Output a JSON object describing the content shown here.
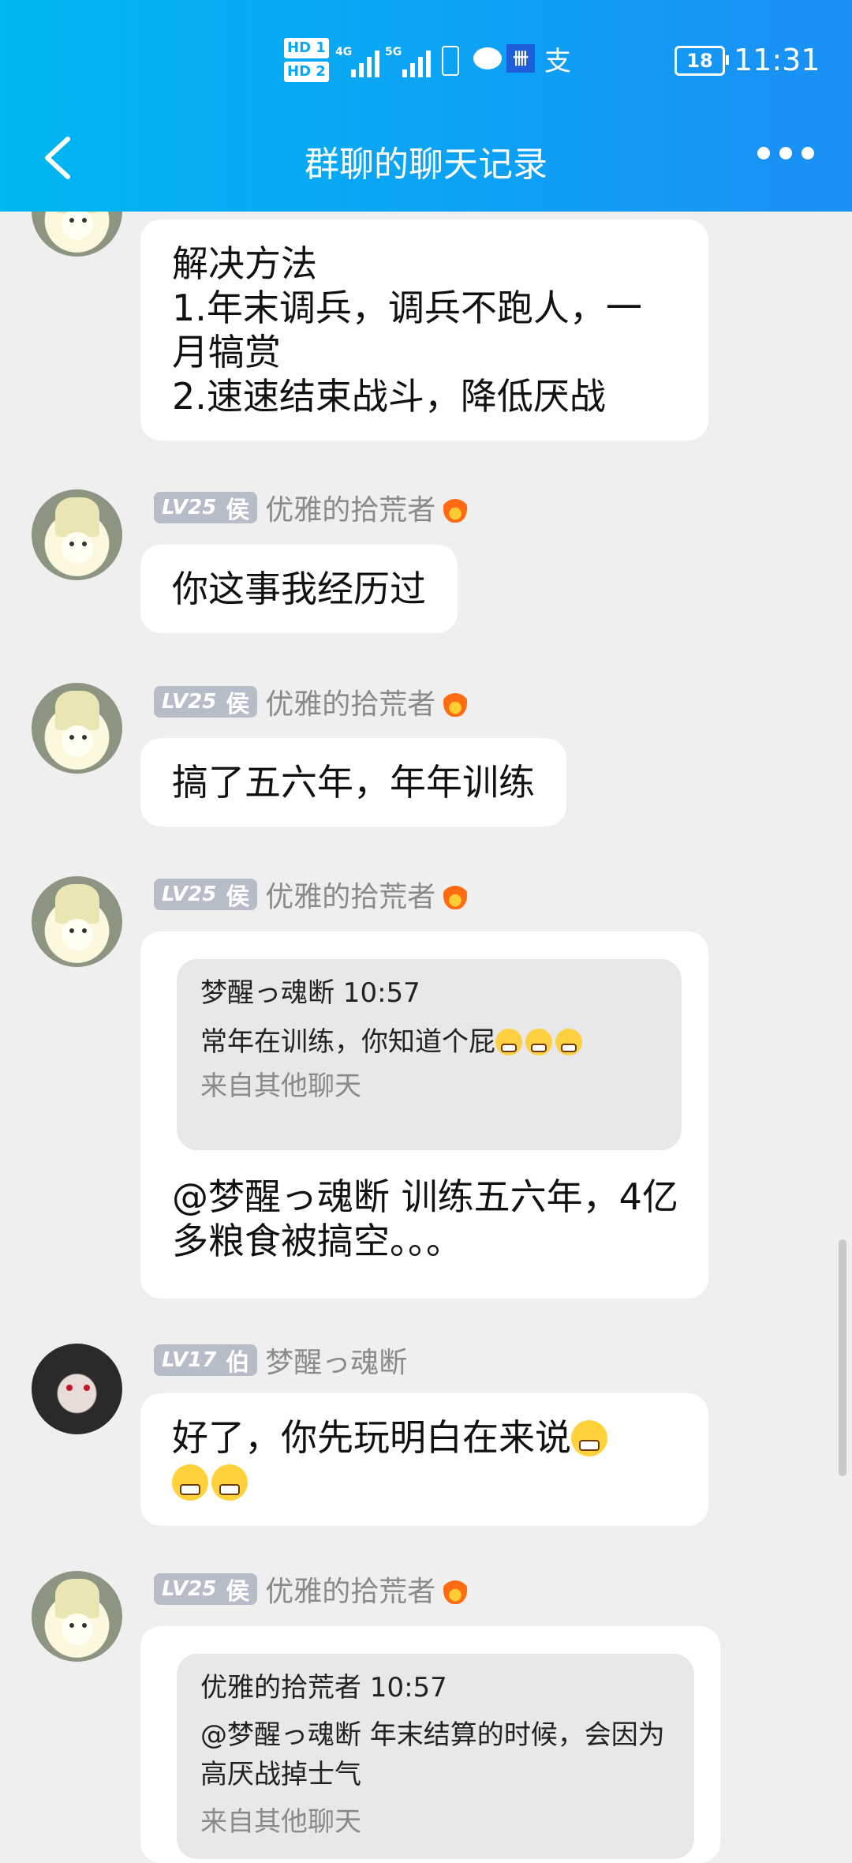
{
  "status_bar": {
    "hd1": "HD 1",
    "hd2": "HD 2",
    "net1": "4G",
    "net2": "5G",
    "alipay_glyph": "支",
    "app_glyph": "卌",
    "battery": "18",
    "time": "11:31"
  },
  "nav": {
    "title": "群聊的聊天记录"
  },
  "messages": [
    {
      "text": "解决方法\n1.年末调兵，调兵不跑人，一月犒赏\n2.速速结束战斗，降低厌战"
    },
    {
      "level": "LV25",
      "title": "侯",
      "name": "优雅的拾荒者",
      "text": "你这事我经历过"
    },
    {
      "level": "LV25",
      "title": "侯",
      "name": "优雅的拾荒者",
      "text": "搞了五六年，年年训练"
    },
    {
      "level": "LV25",
      "title": "侯",
      "name": "优雅的拾荒者",
      "quote": {
        "header": "梦醒っ魂断 10:57",
        "body": "常年在训练，你知道个屁",
        "source": "来自其他聊天"
      },
      "text": "@梦醒っ魂断 训练五六年，4亿多粮食被搞空。。。"
    },
    {
      "level": "LV17",
      "title": "伯",
      "name": "梦醒っ魂断",
      "text": "好了，你先玩明白在来说"
    },
    {
      "level": "LV25",
      "title": "侯",
      "name": "优雅的拾荒者",
      "quote": {
        "header": "优雅的拾荒者 10:57",
        "body": "@梦醒っ魂断 年末结算的时候，会因为高厌战掉士气",
        "source": "来自其他聊天"
      }
    }
  ]
}
